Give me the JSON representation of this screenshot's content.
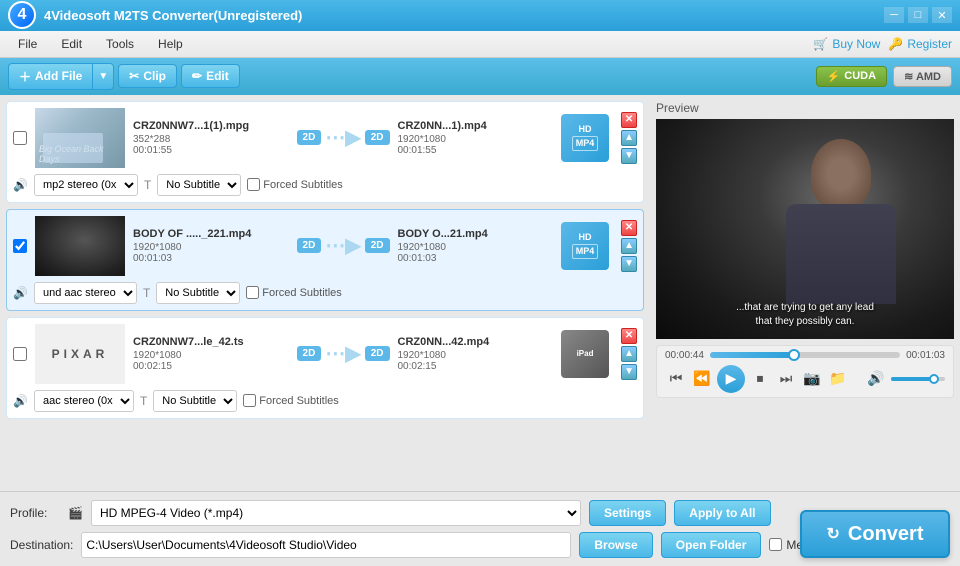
{
  "titleBar": {
    "title": "4Videosoft M2TS Converter(Unregistered)",
    "logo": "4",
    "minBtn": "─",
    "maxBtn": "□",
    "closeBtn": "✕"
  },
  "menuBar": {
    "items": [
      "File",
      "Edit",
      "Tools",
      "Help"
    ],
    "buyNow": "Buy Now",
    "register": "Register"
  },
  "toolbar": {
    "addFile": "Add File",
    "clip": "Clip",
    "edit": "Edit",
    "cuda": "CUDA",
    "amd": "AMD"
  },
  "preview": {
    "label": "Preview",
    "subtitleText": "...that are trying to get any lead\nthat they possibly can.",
    "timeStart": "00:00:44",
    "timeEnd": "00:01:03",
    "progressPct": 44
  },
  "files": [
    {
      "id": 1,
      "inputName": "CRZ0NNW7...1(1).mpg",
      "inputResolution": "352*288",
      "inputDuration": "00:01:55",
      "outputName": "CRZ0NN...1).mp4",
      "outputResolution": "1920*1080",
      "outputDuration": "00:01:55",
      "audioTrack": "mp2 stereo (0x",
      "subtitle": "No Subtitle",
      "forcedSub": "Forced Subtitles",
      "format": "HD\nMP4",
      "selected": false
    },
    {
      "id": 2,
      "inputName": "BODY OF ....._221.mp4",
      "inputResolution": "1920*1080",
      "inputDuration": "00:01:03",
      "outputName": "BODY O...21.mp4",
      "outputResolution": "1920*1080",
      "outputDuration": "00:01:03",
      "audioTrack": "und aac stereo",
      "subtitle": "No Subtitle",
      "forcedSub": "Forced Subtitles",
      "format": "HD\nMP4",
      "selected": true
    },
    {
      "id": 3,
      "inputName": "CRZ0NNW7...le_42.ts",
      "inputResolution": "1920*1080",
      "inputDuration": "00:02:15",
      "outputName": "CRZ0NN...42.mp4",
      "outputResolution": "1920*1080",
      "outputDuration": "00:02:15",
      "audioTrack": "aac stereo (0x",
      "subtitle": "No Subtitle",
      "forcedSub": "Forced Subtitles",
      "format": "iPad",
      "selected": false
    }
  ],
  "bottomBar": {
    "profileLabel": "Profile:",
    "profileValue": "HD MPEG-4 Video (*.mp4)",
    "destinationLabel": "Destination:",
    "destinationValue": "C:\\Users\\User\\Documents\\4Videosoft Studio\\Video",
    "settingsBtn": "Settings",
    "applyToAllBtn": "Apply to All",
    "browseBtn": "Browse",
    "openFolderBtn": "Open Folder",
    "mergeLabel": "Merge into one file",
    "convertBtn": "Convert"
  }
}
